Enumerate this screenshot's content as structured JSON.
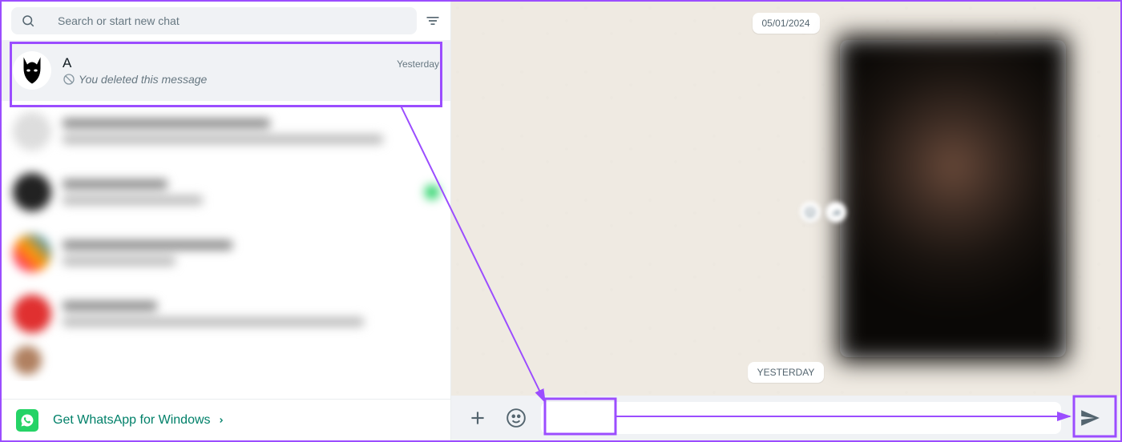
{
  "search": {
    "placeholder": "Search or start new chat"
  },
  "selected_chat": {
    "name_initial": "A",
    "time": "Yesterday",
    "preview": "You deleted this message"
  },
  "promo": {
    "text": "Get WhatsApp for Windows"
  },
  "dates": {
    "top": "05/01/2024",
    "bottom": "YESTERDAY"
  },
  "composer": {
    "placeholder": ""
  }
}
